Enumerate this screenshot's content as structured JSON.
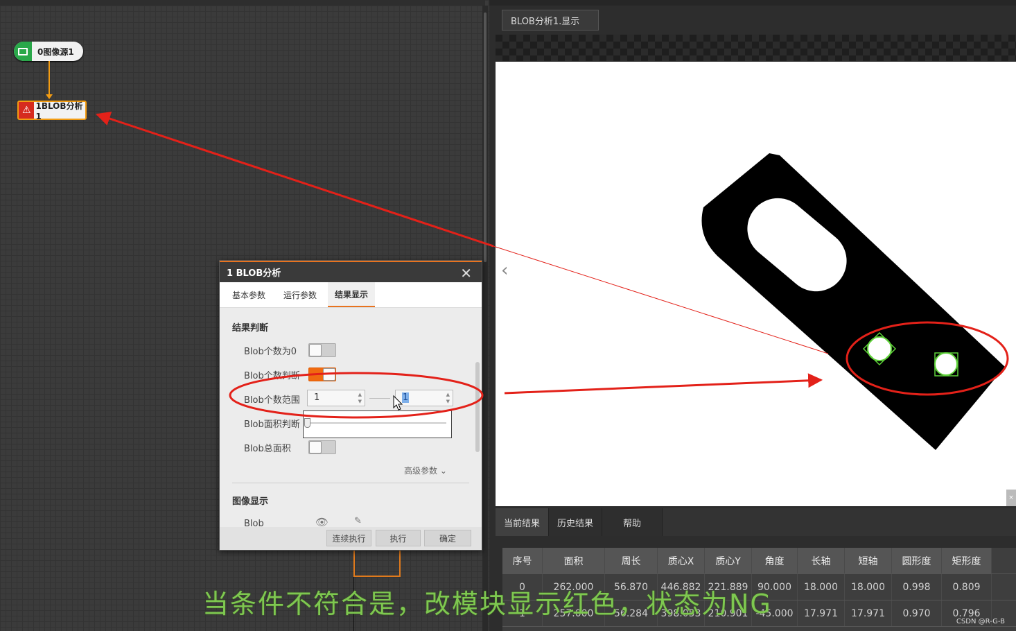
{
  "flow": {
    "nodes": [
      {
        "label": "0图像源1",
        "icon": "image-icon"
      },
      {
        "label": "1BLOB分析1",
        "icon": "warning-triangle-icon"
      }
    ]
  },
  "dialog": {
    "title": "1 BLOB分析",
    "tabs": [
      "基本参数",
      "运行参数",
      "结果显示"
    ],
    "active_tab": "结果显示",
    "section_result": "结果判断",
    "rows": [
      {
        "label": "Blob个数为0",
        "toggle": "off"
      },
      {
        "label": "Blob个数判断",
        "toggle": "on"
      },
      {
        "label": "Blob个数范围",
        "min": "1",
        "max": "1"
      },
      {
        "label": "Blob面积判断"
      },
      {
        "label": "Blob总面积",
        "toggle": "off"
      }
    ],
    "advanced": "高级参数",
    "section_display": "图像显示",
    "display_row": "Blob",
    "buttons": [
      "连续执行",
      "执行",
      "确定"
    ]
  },
  "viewer": {
    "tab": "BLOB分析1.显示"
  },
  "results": {
    "tabs": [
      "当前结果",
      "历史结果",
      "帮助"
    ],
    "headers": [
      "序号",
      "面积",
      "周长",
      "质心X",
      "质心Y",
      "角度",
      "长轴",
      "短轴",
      "圆形度",
      "矩形度"
    ],
    "rows": [
      [
        "0",
        "262.000",
        "56.870",
        "446.882",
        "221.889",
        "90.000",
        "18.000",
        "18.000",
        "0.998",
        "0.809"
      ],
      [
        "1",
        "257.000",
        "56.284",
        "398.053",
        "210.901",
        "-45.000",
        "17.971",
        "17.971",
        "0.970",
        "0.796"
      ]
    ]
  },
  "caption": "当条件不符合是，改模块显示红色，状态为NG",
  "watermark": "CSDN @R-G-B",
  "colors": {
    "accent": "#e8731f",
    "annotation": "#e32119",
    "caption": "#7ec850",
    "node_error": "#d62b1f",
    "node_ok": "#2aa84a"
  }
}
